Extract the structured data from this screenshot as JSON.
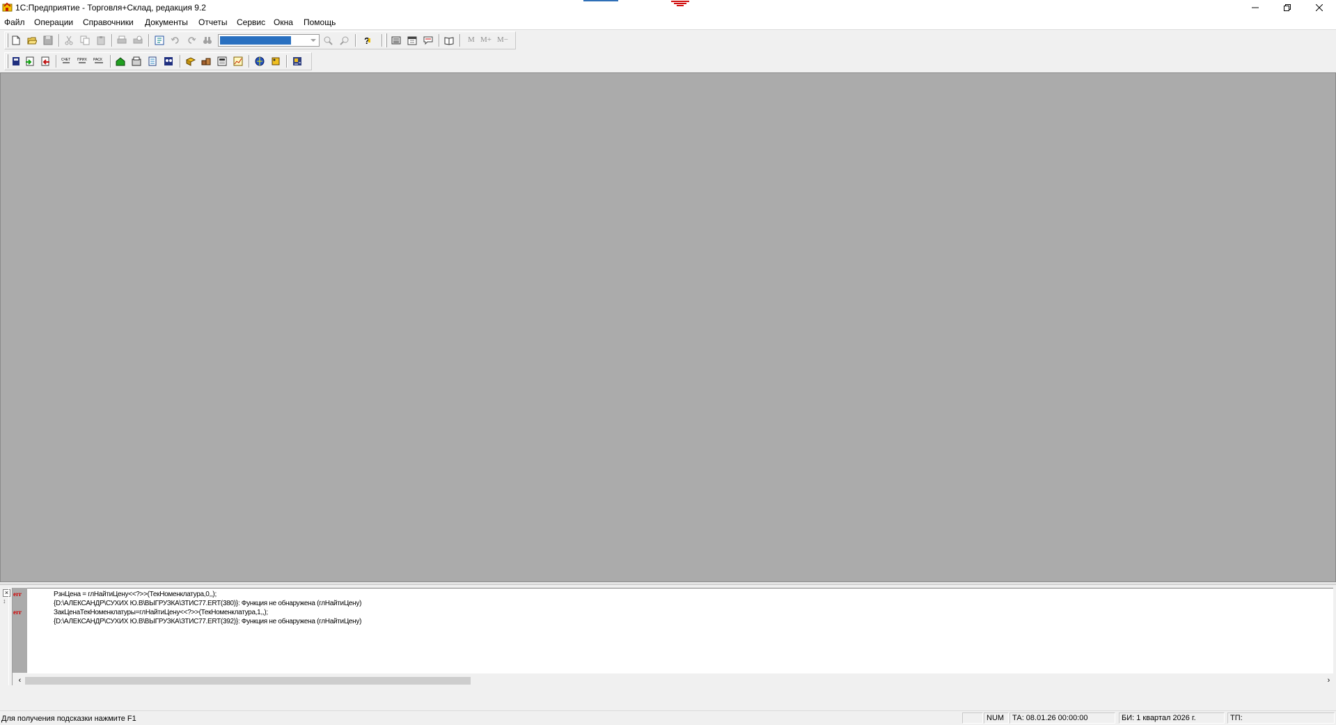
{
  "window": {
    "title": "1С:Предприятие - Торговля+Склад, редакция 9.2",
    "controls": {
      "minimize": "minimize-icon",
      "restore": "restore-icon",
      "close": "close-icon"
    }
  },
  "menu": {
    "items": [
      "Файл",
      "Операции",
      "Справочники",
      "Документы",
      "Отчеты",
      "Сервис",
      "Окна",
      "Помощь"
    ]
  },
  "toolbar": {
    "memory_buttons": [
      "M",
      "M+",
      "M−"
    ]
  },
  "messages": {
    "lines": [
      {
        "tag": "err",
        "text": "РзнЦена = глНайтиЦену<<?>>(ТекНоменклатура,0,,);"
      },
      {
        "tag": "",
        "text": "{D:\\АЛЕКСАНДР\\СУХИХ Ю.В\\ВЫГРУЗКА\\ЗТИС77.ERT(380)}: Функция не обнаружена (глНайтиЦену)"
      },
      {
        "tag": "err",
        "text": "ЗакЦенаТекНоменклатуры=глНайтиЦену<<?>>(ТекНоменклатура,1,,);"
      },
      {
        "tag": "",
        "text": "{D:\\АЛЕКСАНДР\\СУХИХ Ю.В\\ВЫГРУЗКА\\ЗТИС77.ERT(392)}: Функция не обнаружена (глНайтиЦену)"
      }
    ]
  },
  "status": {
    "hint": "Для получения подсказки нажмите F1",
    "num": "NUM",
    "ta": "ТА: 08.01.26  00:00:00",
    "bi": "БИ: 1 квартал 2026 г.",
    "tp": "ТП:"
  },
  "colors": {
    "mdi_background": "#ababab",
    "error_tag": "#d00000",
    "selection": "#2970c0"
  }
}
